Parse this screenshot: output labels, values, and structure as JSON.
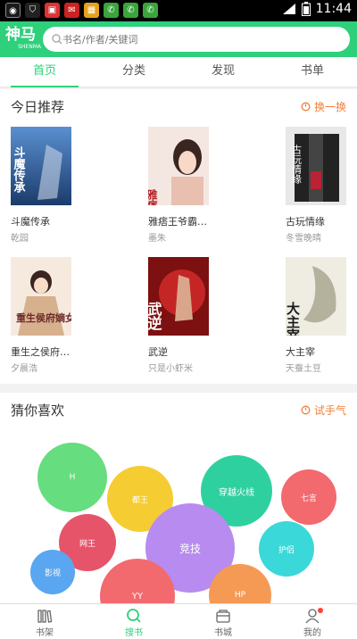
{
  "statusbar": {
    "time": "11:44",
    "icons": [
      "app-icon",
      "shield-icon",
      "notice-icon",
      "news-icon",
      "store-icon",
      "wechat-icon",
      "wechat-icon",
      "wechat-icon"
    ]
  },
  "header": {
    "logo_main": "神马",
    "logo_sub": "SHENMA",
    "search_placeholder": "书名/作者/关键词"
  },
  "tabs": [
    {
      "label": "首页",
      "active": true
    },
    {
      "label": "分类"
    },
    {
      "label": "发现"
    },
    {
      "label": "书单"
    }
  ],
  "today": {
    "title": "今日推荐",
    "action": "换一换",
    "books": [
      {
        "title": "斗魔传承",
        "author": "乾园",
        "cover_text": "斗魔传承",
        "cover_colors": [
          "#1b3c6b",
          "#5a8fd0"
        ]
      },
      {
        "title": "雅痞王爷霸…",
        "author": "墨朱",
        "cover_text": "雅痞王爷霸乱",
        "cover_colors": [
          "#f4e7e2",
          "#b41f24"
        ]
      },
      {
        "title": "古玩情缘",
        "author": "冬雪晚晴",
        "cover_text": "古玩情缘",
        "cover_colors": [
          "#e8e8e8",
          "#222222"
        ]
      },
      {
        "title": "重生之侯府…",
        "author": "夕晨浩",
        "cover_text": "重生侯府嫡女",
        "cover_colors": [
          "#f6eadf",
          "#c9a37a"
        ]
      },
      {
        "title": "武逆",
        "author": "只是小虾米",
        "cover_text": "武逆",
        "cover_colors": [
          "#7d1010",
          "#e23030"
        ]
      },
      {
        "title": "大主宰",
        "author": "天蚕土豆",
        "cover_text": "大主宰",
        "cover_colors": [
          "#efece2",
          "#5b5b43"
        ]
      }
    ]
  },
  "guess": {
    "title": "猜你喜欢",
    "action": "试手气",
    "bubbles": [
      {
        "label": "H",
        "color": "#66dd7e"
      },
      {
        "label": "都王",
        "color": "#f6cc33"
      },
      {
        "label": "穿越火线",
        "color": "#2fd0a0"
      },
      {
        "label": "七言",
        "color": "#f26a6e"
      },
      {
        "label": "网王",
        "color": "#e6546a"
      },
      {
        "label": "竞技",
        "color": "#b78bef"
      },
      {
        "label": "护侣",
        "color": "#3ad8d8"
      },
      {
        "label": "影视",
        "color": "#5aa6f0"
      },
      {
        "label": "YY",
        "color": "#f26a6e"
      },
      {
        "label": "HP",
        "color": "#f59a55"
      }
    ]
  },
  "bottomnav": [
    {
      "label": "书架",
      "icon": "bookshelf-icon"
    },
    {
      "label": "搜书",
      "icon": "search-icon",
      "active": true
    },
    {
      "label": "书城",
      "icon": "bookstore-icon"
    },
    {
      "label": "我的",
      "icon": "user-icon",
      "badge": true
    }
  ]
}
